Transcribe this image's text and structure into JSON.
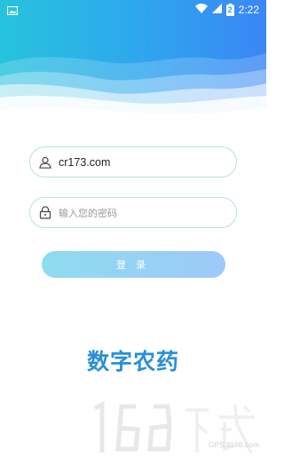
{
  "status_bar": {
    "battery_level": "2",
    "time": "2:22"
  },
  "login_form": {
    "username_value": "cr173.com",
    "password_placeholder": "输入您的密码",
    "login_label": "登录"
  },
  "brand": {
    "app_name": "数字农药"
  },
  "watermark": {
    "logo_text": "168下载",
    "site_text": "GPS.it168.com"
  },
  "colors": {
    "header_start": "#27c3dc",
    "header_end": "#3a86f6",
    "field_border": "#b9e2df",
    "button_start": "#8edcef",
    "button_end": "#9ec9f8",
    "brand_text": "#2a8fd8"
  }
}
